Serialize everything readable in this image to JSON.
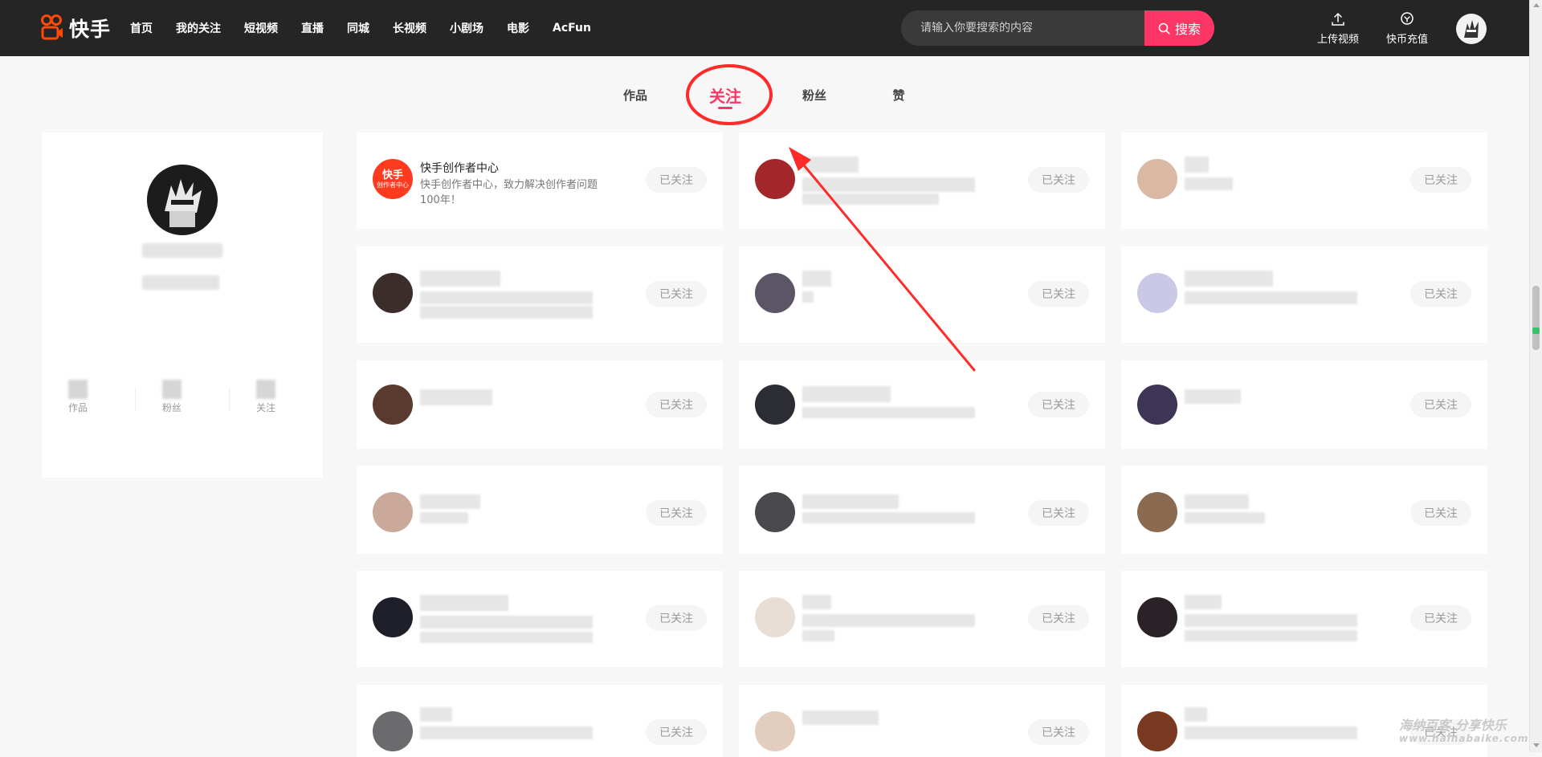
{
  "navbar": {
    "logo_text": "快手",
    "links": [
      "首页",
      "我的关注",
      "短视频",
      "直播",
      "同城",
      "长视频",
      "小剧场",
      "电影",
      "AcFun"
    ],
    "search_placeholder": "请输入你要搜索的内容",
    "search_button": "搜索",
    "upload_label": "上传视频",
    "recharge_label": "快币充值"
  },
  "tabs": [
    {
      "label": "作品",
      "active": false
    },
    {
      "label": "关注",
      "active": true
    },
    {
      "label": "粉丝",
      "active": false
    },
    {
      "label": "赞",
      "active": false
    }
  ],
  "profile": {
    "stats": [
      {
        "label": "作品"
      },
      {
        "label": "粉丝"
      },
      {
        "label": "关注"
      }
    ]
  },
  "follow_button_label": "已关注",
  "followed": [
    {
      "name": "快手创作者中心",
      "desc": "快手创作者中心，致力解决创作者问题100年！",
      "avatar_badge_top": "快手",
      "avatar_badge_bottom": "创作者中心",
      "badge_color": "#fe3a1f"
    }
  ],
  "colors": {
    "accent": "#fe3666",
    "navbar_bg": "#252525",
    "annotation": "#ff2a2a"
  },
  "watermark": {
    "line1": "海纳百客 分享快乐",
    "line2": "www.hainabaike.com"
  }
}
